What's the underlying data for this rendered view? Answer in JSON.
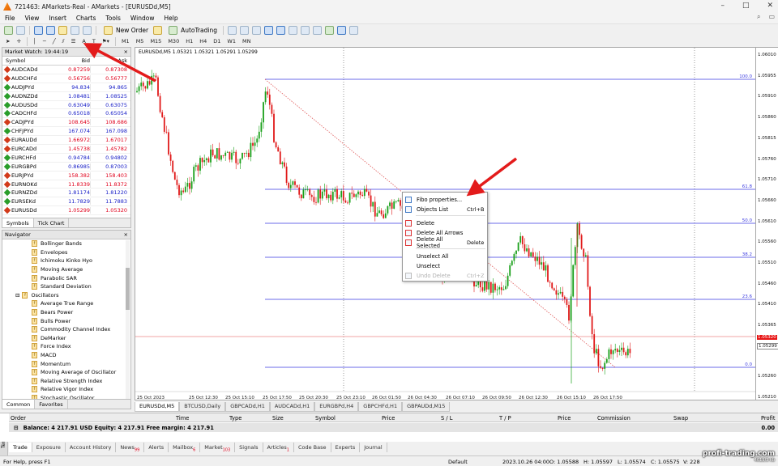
{
  "window": {
    "title": "721463: AMarkets-Real - AMarkets - [EURUSDd,M5]",
    "controls": [
      "–",
      "□",
      "✕"
    ]
  },
  "menu": [
    "File",
    "View",
    "Insert",
    "Charts",
    "Tools",
    "Window",
    "Help"
  ],
  "toolbar": {
    "new_order": "New Order",
    "autotrading": "AutoTrading"
  },
  "timeframes": [
    "M1",
    "M5",
    "M15",
    "M30",
    "H1",
    "H4",
    "D1",
    "W1",
    "MN"
  ],
  "market_watch": {
    "title": "Market Watch: 19:44:19",
    "headers": {
      "symbol": "Symbol",
      "bid": "Bid",
      "ask": "Ask"
    },
    "rows": [
      {
        "symbol": "AUDCADd",
        "bid": "0.87259",
        "ask": "0.87308",
        "dir": "down"
      },
      {
        "symbol": "AUDCHFd",
        "bid": "0.56756",
        "ask": "0.56777",
        "dir": "down"
      },
      {
        "symbol": "AUDJPYd",
        "bid": "94.834",
        "ask": "94.865",
        "dir": "up"
      },
      {
        "symbol": "AUDNZDd",
        "bid": "1.08481",
        "ask": "1.08525",
        "dir": "up"
      },
      {
        "symbol": "AUDUSDd",
        "bid": "0.63049",
        "ask": "0.63075",
        "dir": "up"
      },
      {
        "symbol": "CADCHFd",
        "bid": "0.65018",
        "ask": "0.65054",
        "dir": "up"
      },
      {
        "symbol": "CADJPYd",
        "bid": "108.645",
        "ask": "108.686",
        "dir": "down"
      },
      {
        "symbol": "CHFJPYd",
        "bid": "167.074",
        "ask": "167.098",
        "dir": "up"
      },
      {
        "symbol": "EURAUDd",
        "bid": "1.66972",
        "ask": "1.67017",
        "dir": "down"
      },
      {
        "symbol": "EURCADd",
        "bid": "1.45738",
        "ask": "1.45782",
        "dir": "down"
      },
      {
        "symbol": "EURCHFd",
        "bid": "0.94784",
        "ask": "0.94802",
        "dir": "up"
      },
      {
        "symbol": "EURGBPd",
        "bid": "0.86985",
        "ask": "0.87003",
        "dir": "up"
      },
      {
        "symbol": "EURJPYd",
        "bid": "158.382",
        "ask": "158.403",
        "dir": "down"
      },
      {
        "symbol": "EURNOKd",
        "bid": "11.8339",
        "ask": "11.8372",
        "dir": "down"
      },
      {
        "symbol": "EURNZDd",
        "bid": "1.81174",
        "ask": "1.81220",
        "dir": "up"
      },
      {
        "symbol": "EURSEKd",
        "bid": "11.7829",
        "ask": "11.7883",
        "dir": "up"
      },
      {
        "symbol": "EURUSDd",
        "bid": "1.05299",
        "ask": "1.05320",
        "dir": "down"
      }
    ],
    "tabs": [
      "Symbols",
      "Tick Chart"
    ]
  },
  "navigator": {
    "title": "Navigator",
    "items": [
      {
        "label": "Bollinger Bands",
        "indent": 2
      },
      {
        "label": "Envelopes",
        "indent": 2
      },
      {
        "label": "Ichimoku Kinko Hyo",
        "indent": 2
      },
      {
        "label": "Moving Average",
        "indent": 2
      },
      {
        "label": "Parabolic SAR",
        "indent": 2
      },
      {
        "label": "Standard Deviation",
        "indent": 2
      },
      {
        "label": "Oscillators",
        "indent": 1
      },
      {
        "label": "Average True Range",
        "indent": 2
      },
      {
        "label": "Bears Power",
        "indent": 2
      },
      {
        "label": "Bulls Power",
        "indent": 2
      },
      {
        "label": "Commodity Channel Index",
        "indent": 2
      },
      {
        "label": "DeMarker",
        "indent": 2
      },
      {
        "label": "Force Index",
        "indent": 2
      },
      {
        "label": "MACD",
        "indent": 2
      },
      {
        "label": "Momentum",
        "indent": 2
      },
      {
        "label": "Moving Average of Oscillator",
        "indent": 2
      },
      {
        "label": "Relative Strength Index",
        "indent": 2
      },
      {
        "label": "Relative Vigor Index",
        "indent": 2
      },
      {
        "label": "Stochastic Oscillator",
        "indent": 2
      }
    ],
    "tabs": [
      "Common",
      "Favorites"
    ]
  },
  "chart": {
    "header": "EURUSDd,M5  1.05321 1.05321 1.05291 1.05299",
    "price_axis": [
      "1.06010",
      "1.05955",
      "1.05910",
      "1.05860",
      "1.05815",
      "1.05760",
      "1.05710",
      "1.05660",
      "1.05610",
      "1.05560",
      "1.05510",
      "1.05460",
      "1.05410",
      "1.05365",
      "1.05320",
      "1.05299",
      "1.05260",
      "1.05210"
    ],
    "price_tag_bid": "1.05320",
    "price_tag_cur": "1.05299",
    "time_axis": [
      "25 Oct 2023",
      "25 Oct 12:30",
      "25 Oct 15:10",
      "25 Oct 17:50",
      "25 Oct 20:30",
      "25 Oct 23:10",
      "26 Oct 01:50",
      "26 Oct 04:30",
      "26 Oct 07:10",
      "26 Oct 09:50",
      "26 Oct 12:30",
      "26 Oct 15:10",
      "26 Oct 17:50"
    ],
    "fibo_labels": [
      "100.0",
      "61.8",
      "50.0",
      "38.2",
      "23.6",
      "0.0"
    ]
  },
  "context_menu": [
    {
      "label": "Fibo properties...",
      "key": "",
      "icon": "properties-icon",
      "disabled": false
    },
    {
      "label": "Objects List",
      "key": "Ctrl+B",
      "icon": "list-icon",
      "disabled": false
    },
    {
      "label": "Delete",
      "key": "",
      "icon": "delete-icon",
      "disabled": false
    },
    {
      "label": "Delete All Arrows",
      "key": "",
      "icon": "delete-arrows-icon",
      "disabled": false
    },
    {
      "label": "Delete All Selected",
      "key": "Delete",
      "icon": "delete-selected-icon",
      "disabled": false
    },
    {
      "label": "Unselect All",
      "key": "",
      "icon": "",
      "disabled": false
    },
    {
      "label": "Unselect",
      "key": "",
      "icon": "",
      "disabled": false
    },
    {
      "label": "Undo Delete",
      "key": "Ctrl+Z",
      "icon": "undo-icon",
      "disabled": true
    }
  ],
  "chart_tabs": [
    "EURUSDd,M5",
    "BTCUSD,Daily",
    "GBPCADd,H1",
    "AUDCADd,H1",
    "EURGBPd,H4",
    "GBPCHFd,H1",
    "GBPAUDd,M15"
  ],
  "terminal": {
    "headers": [
      "Order",
      "Time",
      "Type",
      "Size",
      "Symbol",
      "Price",
      "S / L",
      "T / P",
      "Price",
      "Commission",
      "Swap",
      "Profit"
    ],
    "balance": "Balance: 4 217.91 USD  Equity: 4 217.91  Free margin: 4 217.91",
    "profit": "0.00",
    "side_label": "Terminal",
    "tabs": [
      {
        "label": "Trade",
        "badge": ""
      },
      {
        "label": "Exposure",
        "badge": ""
      },
      {
        "label": "Account History",
        "badge": ""
      },
      {
        "label": "News",
        "badge": "99"
      },
      {
        "label": "Alerts",
        "badge": ""
      },
      {
        "label": "Mailbox",
        "badge": "6"
      },
      {
        "label": "Market",
        "badge": "103"
      },
      {
        "label": "Signals",
        "badge": ""
      },
      {
        "label": "Articles",
        "badge": "1"
      },
      {
        "label": "Code Base",
        "badge": ""
      },
      {
        "label": "Experts",
        "badge": ""
      },
      {
        "label": "Journal",
        "badge": ""
      }
    ]
  },
  "status": {
    "help": "For Help, press F1",
    "profile": "Default",
    "datetime": "2023.10.26 04:00",
    "o": "O: 1.05588",
    "h": "H: 1.05597",
    "l": "L: 1.05574",
    "c": "C: 1.05575",
    "v": "V: 228",
    "watermark": "profi-trading.com",
    "watermark_sub": "4619/3 kb"
  },
  "colors": {
    "bull": "#1aa01a",
    "bear": "#e01a1a",
    "fibo": "#3a3ae0",
    "arrow": "#e31b1b"
  }
}
